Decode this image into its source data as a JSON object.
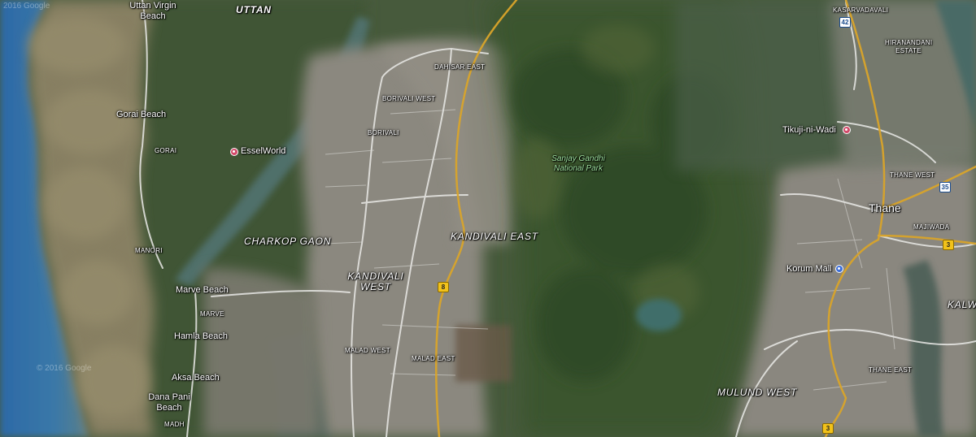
{
  "map": {
    "labels": {
      "uttan": "UTTAN",
      "uttan_virgin_beach_line1": "Uttan Virgin",
      "uttan_virgin_beach_line2": "Beach",
      "gorai_beach": "Gorai Beach",
      "gorai": "GORAI",
      "esselworld": "EsselWorld",
      "charkop_gaon": "CHARKOP GAON",
      "manori": "MANORI",
      "marve_beach": "Marve Beach",
      "marve": "MARVE",
      "hamla_beach": "Hamla Beach",
      "aksa_beach": "Aksa Beach",
      "dana_pani_line1": "Dana Pani",
      "dana_pani_line2": "Beach",
      "madh": "MADH",
      "dahisar_east": "DAHISAR EAST",
      "borivali_west": "BORIVALI WEST",
      "borivali": "BORIVALI",
      "kandivali_west_line1": "KANDIVALI",
      "kandivali_west_line2": "WEST",
      "kandivali_east": "KANDIVALI EAST",
      "malad_west": "MALAD WEST",
      "malad_east": "MALAD EAST",
      "sanjay_gandhi_line1": "Sanjay Gandhi",
      "sanjay_gandhi_line2": "National Park",
      "kasarvadavali": "KASARVADAVALI",
      "hiranandani_line1": "HIRANANDANI",
      "hiranandani_line2": "ESTATE",
      "tikuji_ni_wadi": "Tikuji-ni-Wadi",
      "thane_west": "THANE WEST",
      "thane": "Thane",
      "majiwada": "MAJIWADA",
      "korum_mall": "Korum Mall",
      "kalwa": "KALWA",
      "thane_east": "THANE EAST",
      "mulund_west": "MULUND WEST"
    },
    "shields": {
      "nh8": "8",
      "sh42": "42",
      "sh35": "35",
      "nh3_thane": "3",
      "nh3_south": "3"
    },
    "watermarks": {
      "top": "2016 Google",
      "middle": "© 2016 Google"
    },
    "icons": {
      "esselworld": "amusement-park-icon",
      "tikuji": "amusement-park-icon",
      "korum_mall": "shopping-icon"
    },
    "colors": {
      "sea": "#2f6ea8",
      "silt": "#8a8060",
      "forest": "#3a5a30",
      "urban": "#8d8a83",
      "road": "#ececec",
      "highway": "#e0a92a"
    }
  }
}
